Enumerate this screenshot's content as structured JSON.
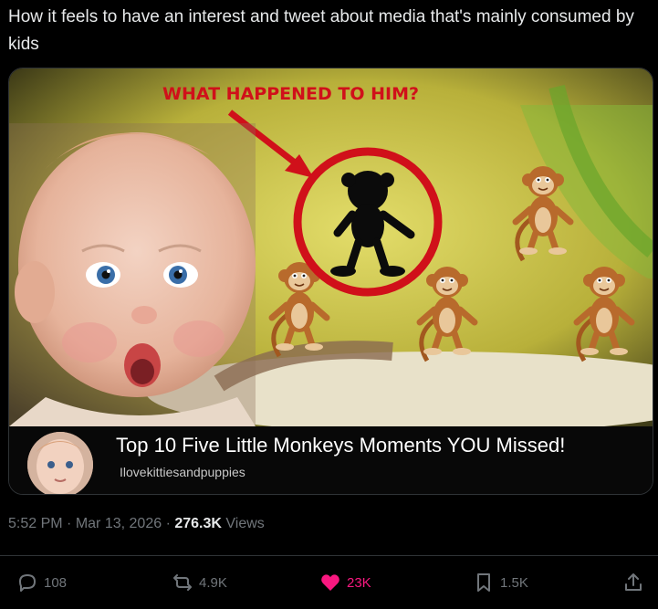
{
  "tweet": {
    "text": "How it feels to have an interest and tweet about media that's mainly consumed by kids",
    "timestamp": "5:52 PM",
    "separator": "·",
    "date": "Mar 13, 2026",
    "views_count": "276.3K",
    "views_label": "Views"
  },
  "thumbnail": {
    "overlay_text": "WHAT HAPPENED TO HIM?",
    "accent_red": "#d0101a",
    "background_yellow": "#d9d24a"
  },
  "video": {
    "title": "Top 10 Five Little Monkeys Moments YOU Missed!",
    "channel": "Ilovekittiesandpuppies"
  },
  "actions": {
    "replies": "108",
    "reposts": "4.9K",
    "likes": "23K",
    "bookmarks": "1.5K",
    "liked": true,
    "like_color": "#f91880"
  },
  "icons": [
    "reply-icon",
    "repost-icon",
    "like-icon",
    "bookmark-icon",
    "share-icon"
  ]
}
